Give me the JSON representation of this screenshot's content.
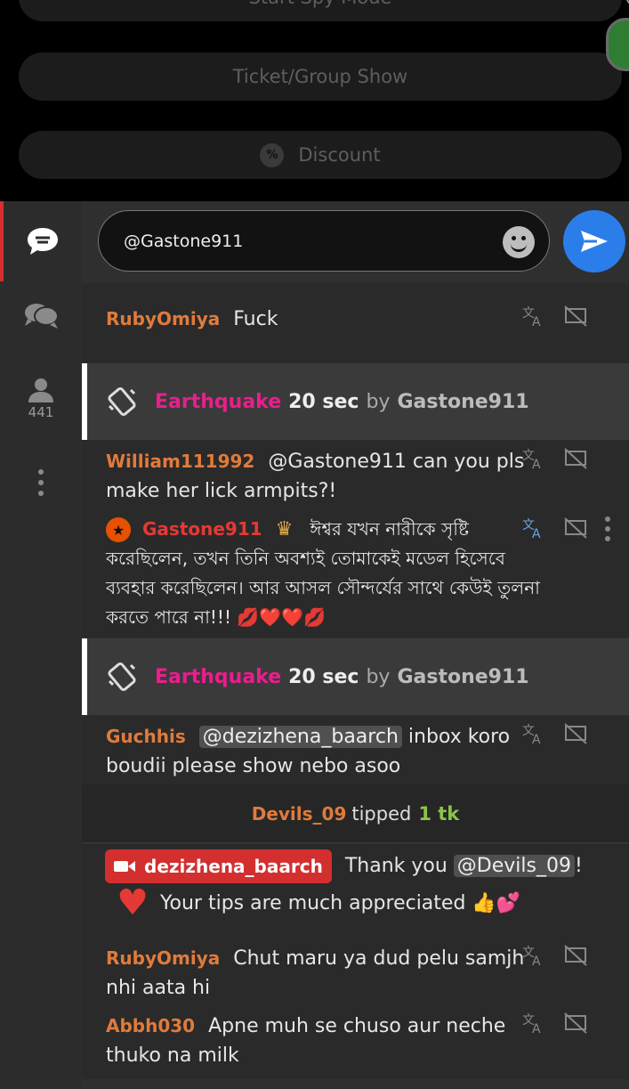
{
  "top": {
    "spy_label": "Start Spy Mode",
    "ticket_label": "Ticket/Group Show",
    "discount_label": "Discount",
    "discount_icon_text": "%"
  },
  "sidebar": {
    "users_count": "441"
  },
  "input": {
    "value": "@Gastone911"
  },
  "messages": {
    "m1": {
      "user": "RubyOmiya",
      "text": "Fuck"
    },
    "quake1": {
      "name": "Earthquake",
      "duration": "20 sec",
      "by": "by",
      "user": "Gastone911"
    },
    "m2": {
      "user": "William111992",
      "text": "@Gastone911  can you pls make her lick armpits?!"
    },
    "m3": {
      "user": "Gastone911",
      "text": "ঈশ্বর যখন নারীকে সৃষ্টি করেছিলেন, তখন তিনি অবশ্যই তোমাকেই মডেল হিসেবে ব্যবহার করেছিলেন। আর আসল সৌন্দর্যের সাথে কেউই তুলনা করতে পারে না!!! 💋❤️❤️💋"
    },
    "quake2": {
      "name": "Earthquake",
      "duration": "20 sec",
      "by": "by",
      "user": "Gastone911"
    },
    "m4": {
      "user": "Guchhis",
      "mention": "@dezizhena_baarch",
      "text": " inbox koro boudii please show nebo asoo"
    },
    "tip": {
      "user": "Devils_09",
      "action": "tipped",
      "amount": "1 tk"
    },
    "m5": {
      "model": "dezizhena_baarch",
      "text1": "Thank you ",
      "mention": "@Devils_09",
      "text2": "!",
      "text3": "Your tips are much appreciated 👍💕"
    },
    "m6": {
      "user": "RubyOmiya",
      "text": "Chut maru ya dud pelu samjh nhi aata hi"
    },
    "m7": {
      "user": "Abbh030",
      "text": "Apne muh se chuso aur neche thuko na milk"
    }
  },
  "colors": {
    "accent_blue": "#2b7de9",
    "username_orange": "#e07b3c",
    "earthquake_pink": "#e91e8c",
    "model_red": "#d32f2f",
    "tip_green": "#8bc34a"
  }
}
